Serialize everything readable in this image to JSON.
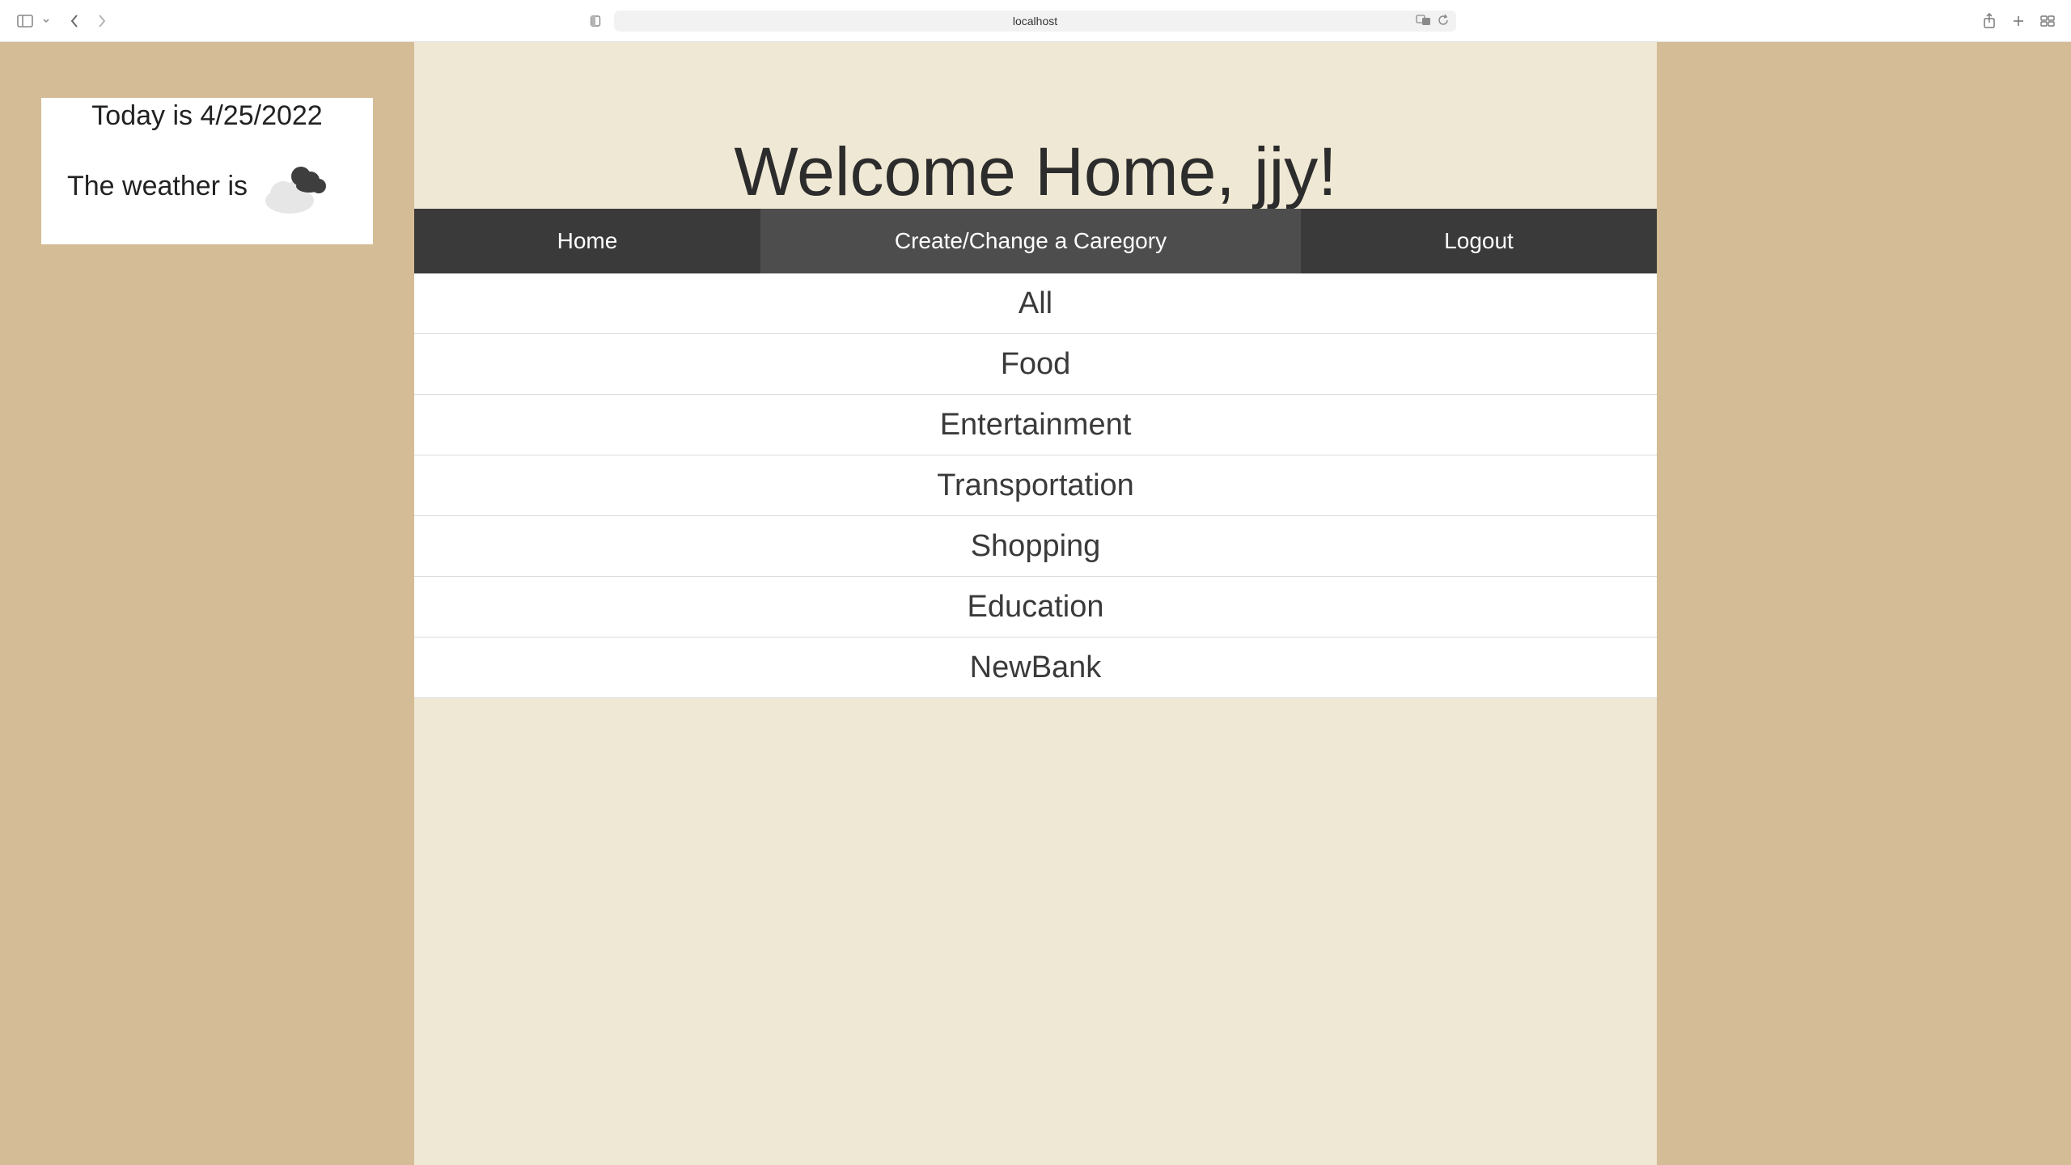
{
  "browser": {
    "url": "localhost"
  },
  "widget": {
    "today_text": "Today is 4/25/2022",
    "weather_label": "The weather is",
    "weather_icon": "cloudy-icon"
  },
  "main": {
    "title": "Welcome Home, jjy!",
    "nav": {
      "home": "Home",
      "create": "Create/Change a Caregory",
      "logout": "Logout"
    },
    "categories": [
      "All",
      "Food",
      "Entertainment",
      "Transportation",
      "Shopping",
      "Education",
      "NewBank"
    ]
  },
  "colors": {
    "page_background": "#d4bc96",
    "panel_background": "#efe8d4",
    "navbar": "#3a3a3a",
    "navbar_active": "#4d4d4d"
  }
}
